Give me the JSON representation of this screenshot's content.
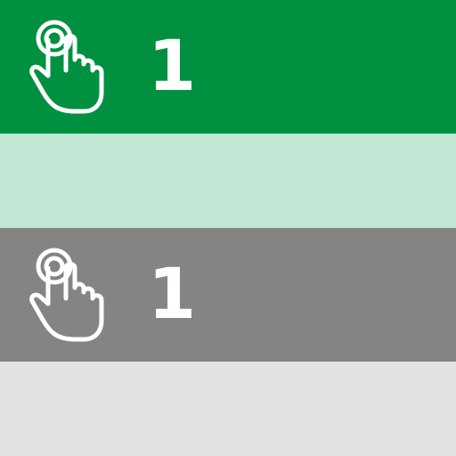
{
  "rows": [
    {
      "state": "active",
      "value": "1",
      "icon": "tap-hand-icon",
      "colors": {
        "bar": "#009140",
        "panel": "#c2e6d4",
        "foreground": "#ffffff"
      }
    },
    {
      "state": "inactive",
      "value": "1",
      "icon": "tap-hand-icon",
      "colors": {
        "bar": "#858483",
        "panel": "#e2e2e2",
        "foreground": "#ffffff"
      }
    }
  ]
}
